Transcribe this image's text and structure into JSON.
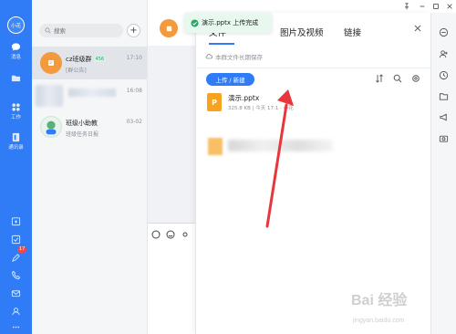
{
  "sidebar": {
    "user_avatar": "小花",
    "items": [
      {
        "label": "消息",
        "icon": "chat-bubble-icon"
      },
      {
        "label": "",
        "icon": "folder-icon"
      },
      {
        "label": "工作",
        "icon": "grid-apps-icon"
      },
      {
        "label": "通讯录",
        "icon": "contacts-book-icon"
      }
    ],
    "bottom_icons": [
      "calendar-icon",
      "todo-check-icon",
      "pen-icon",
      "phone-icon",
      "mail-icon",
      "share-icon",
      "more-icon"
    ],
    "badge_count": "17"
  },
  "conversations": {
    "search_placeholder": "搜索",
    "items": [
      {
        "name": "cz班级群",
        "tag": "456",
        "sub": "[群公告]",
        "time": "17:10",
        "active": true
      },
      {
        "name": "",
        "sub": "",
        "time": "16:08",
        "active": false
      },
      {
        "name": "班级小助教",
        "sub": "班级任务日报",
        "time": "03-02",
        "active": false
      }
    ]
  },
  "toast": {
    "text": "演示.pptx 上传完成",
    "icon": "check-circle-icon"
  },
  "panel": {
    "tabs": [
      {
        "label": "文件"
      },
      {
        "label": "图片及视频"
      },
      {
        "label": "链接"
      }
    ],
    "active_tab": "文件",
    "storage_notice": "本群文件长期保存",
    "upload_button": "上传 / 新建",
    "files": [
      {
        "name": "演示.pptx",
        "meta": "325.8 KB | 今天 17:1 · 小花",
        "icon_letter": "P"
      }
    ]
  },
  "watermark": {
    "main": "Bai 经验",
    "sub": "jingyan.baidu.com"
  },
  "colors": {
    "brand": "#2f7cf6",
    "success": "#27a86a",
    "file_orange": "#f8a31f",
    "arrow_red": "#e8363d"
  }
}
